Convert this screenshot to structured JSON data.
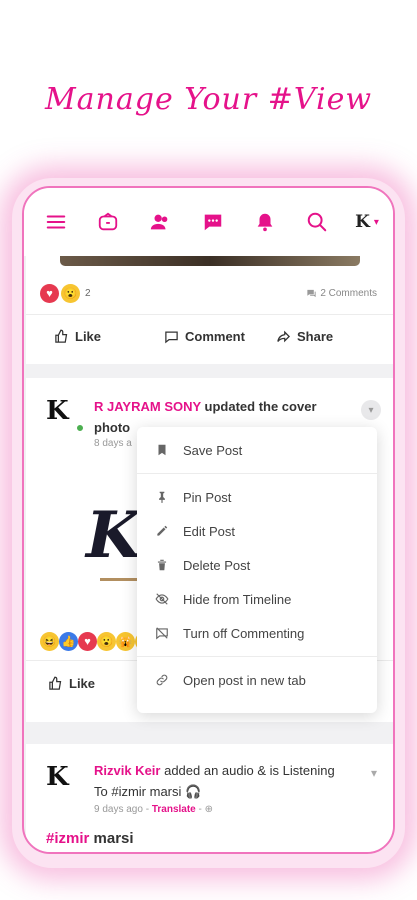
{
  "headline": "Manage Your #View",
  "nav": {
    "profile_initial": "K",
    "caret": "▾",
    "icons": [
      "menu-icon",
      "wallet-icon",
      "friends-icon",
      "messages-icon",
      "bell-icon",
      "search-icon"
    ]
  },
  "post1": {
    "reaction_count": "2",
    "comments": "2 Comments",
    "actions": {
      "like": "Like",
      "comment": "Comment",
      "share": "Share"
    }
  },
  "post2": {
    "avatar_initial": "K",
    "author": "R JAYRAM SONY",
    "headline_rest": " updated the cover photo",
    "meta": "8 days a",
    "cover_letter": "K",
    "like": "Like"
  },
  "menu": {
    "items": [
      {
        "label": "Save Post",
        "icon": "bookmark-icon"
      },
      {
        "label": "Pin Post",
        "icon": "pin-icon"
      },
      {
        "label": "Edit Post",
        "icon": "pencil-icon"
      },
      {
        "label": "Delete Post",
        "icon": "trash-icon"
      },
      {
        "label": "Hide from Timeline",
        "icon": "eye-off-icon"
      },
      {
        "label": "Turn off Commenting",
        "icon": "comment-off-icon"
      },
      {
        "label": "Open post in new tab",
        "icon": "link-icon"
      }
    ]
  },
  "post3": {
    "avatar_initial": "K",
    "author": "Rizvik Keir",
    "headline_rest": " added an audio & is Listening To #izmir marsi 🎧",
    "time": "9 days ago",
    "meta_sep": " - ",
    "translate": "Translate",
    "globe": " - ⊕",
    "hashtag": "#izmir",
    "hashtag_rest": " marsi"
  },
  "colors": {
    "accent": "#e5128a",
    "online": "#4caf50"
  }
}
